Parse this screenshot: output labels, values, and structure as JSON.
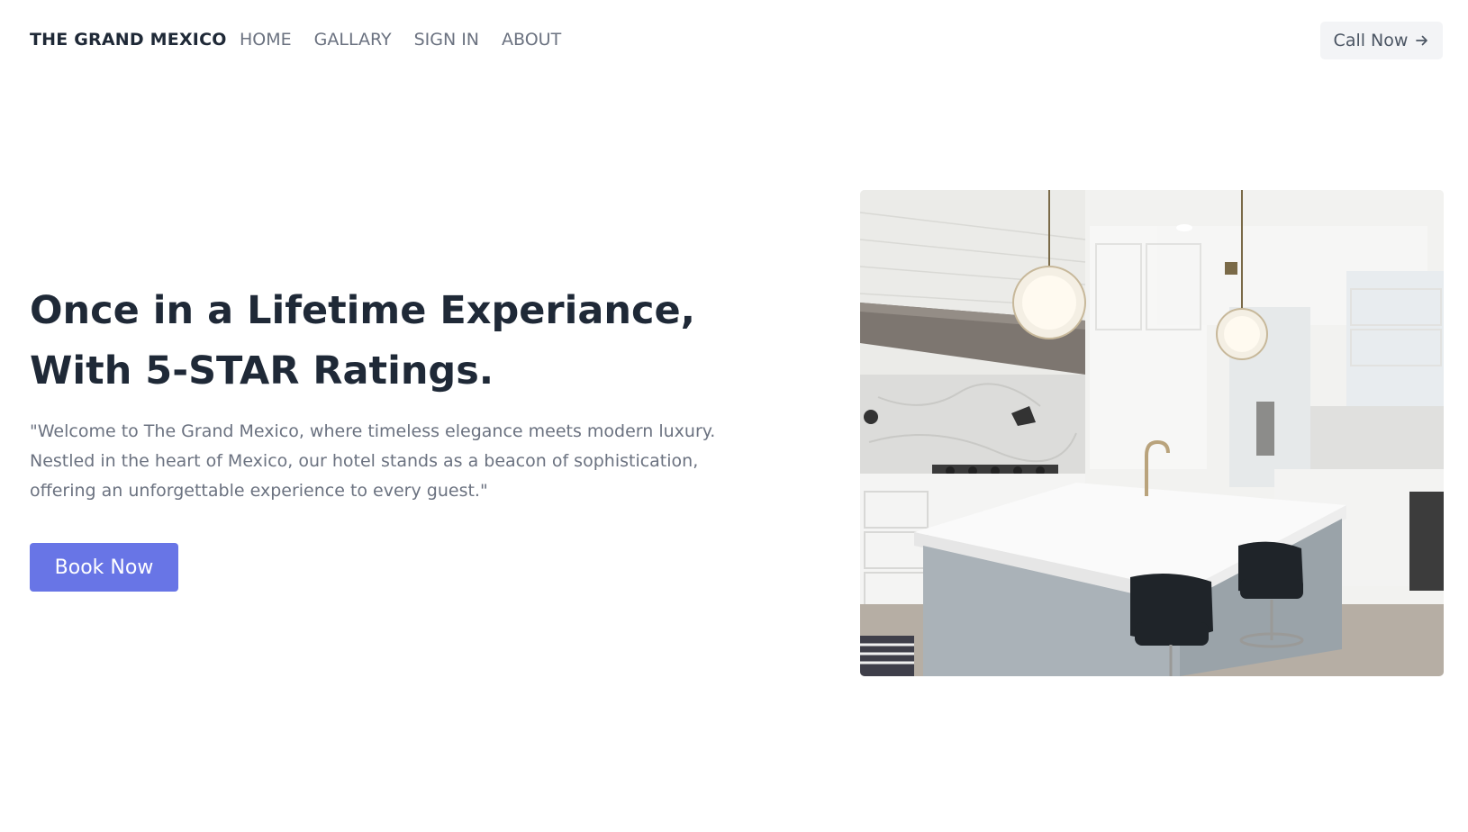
{
  "header": {
    "brand": "THE GRAND MEXICO",
    "nav": [
      "HOME",
      "GALLARY",
      "SIGN IN",
      "ABOUT"
    ],
    "call_label": "Call Now"
  },
  "hero": {
    "title_line1": "Once in a Lifetime Experiance,",
    "title_line2": "With 5-STAR Ratings.",
    "description": "\"Welcome to The Grand Mexico, where timeless elegance meets modern luxury. Nestled in the heart of Mexico, our hotel stands as a beacon of sophistication, offering an unforgettable experience to every guest.\"",
    "book_label": "Book Now",
    "image_subject": "white-kitchen-with-island-and-pendant-lights"
  },
  "colors": {
    "primary": "#6875e6",
    "heading": "#1f2937",
    "muted": "#6b7280",
    "call_bg": "#f3f4f6"
  }
}
